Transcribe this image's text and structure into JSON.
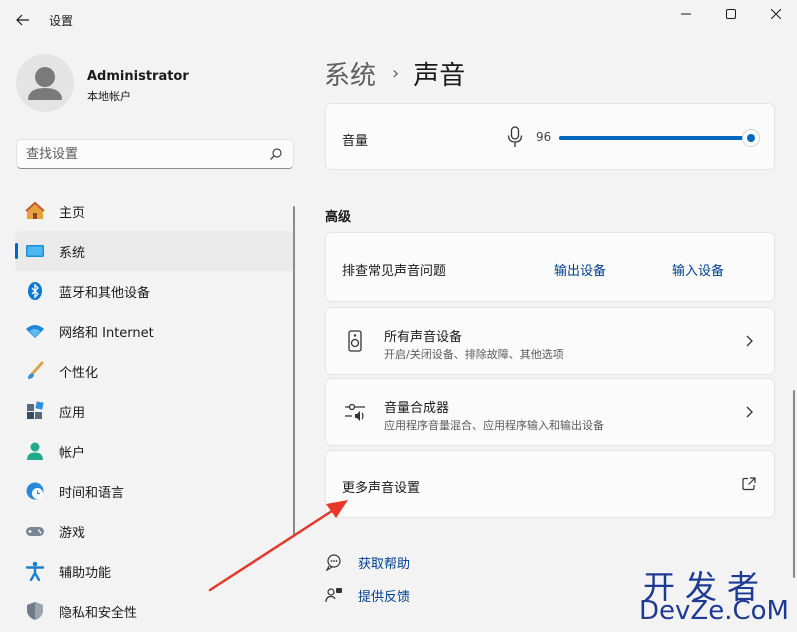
{
  "window": {
    "title": "设置",
    "accent_color": "#0067c0"
  },
  "user": {
    "name": "Administrator",
    "account_type": "本地帐户"
  },
  "search": {
    "placeholder": "查找设置"
  },
  "sidebar": {
    "items": [
      {
        "label": "主页",
        "icon": "home-icon",
        "selected": false
      },
      {
        "label": "系统",
        "icon": "monitor-icon",
        "selected": true
      },
      {
        "label": "蓝牙和其他设备",
        "icon": "bluetooth-icon",
        "selected": false
      },
      {
        "label": "网络和 Internet",
        "icon": "wifi-icon",
        "selected": false
      },
      {
        "label": "个性化",
        "icon": "brush-icon",
        "selected": false
      },
      {
        "label": "应用",
        "icon": "apps-icon",
        "selected": false
      },
      {
        "label": "帐户",
        "icon": "account-icon",
        "selected": false
      },
      {
        "label": "时间和语言",
        "icon": "clock-globe-icon",
        "selected": false
      },
      {
        "label": "游戏",
        "icon": "gamepad-icon",
        "selected": false
      },
      {
        "label": "辅助功能",
        "icon": "accessibility-icon",
        "selected": false
      },
      {
        "label": "隐私和安全性",
        "icon": "shield-icon",
        "selected": false
      }
    ]
  },
  "breadcrumb": {
    "parent": "系统",
    "separator": "›",
    "current": "声音"
  },
  "volume": {
    "label": "音量",
    "value": "96",
    "level_percent": 96
  },
  "advanced": {
    "title": "高级",
    "troubleshoot": {
      "label": "排查常见声音问题",
      "output_link": "输出设备",
      "input_link": "输入设备"
    },
    "all_devices": {
      "title": "所有声音设备",
      "description": "开启/关闭设备、排除故障、其他选项"
    },
    "mixer": {
      "title": "音量合成器",
      "description": "应用程序音量混合、应用程序输入和输出设备"
    },
    "more_settings": {
      "label": "更多声音设置"
    }
  },
  "help": {
    "get_help": "获取帮助",
    "feedback": "提供反馈"
  },
  "watermark": {
    "cn": "开发者",
    "en": "DevZe.CoM"
  }
}
